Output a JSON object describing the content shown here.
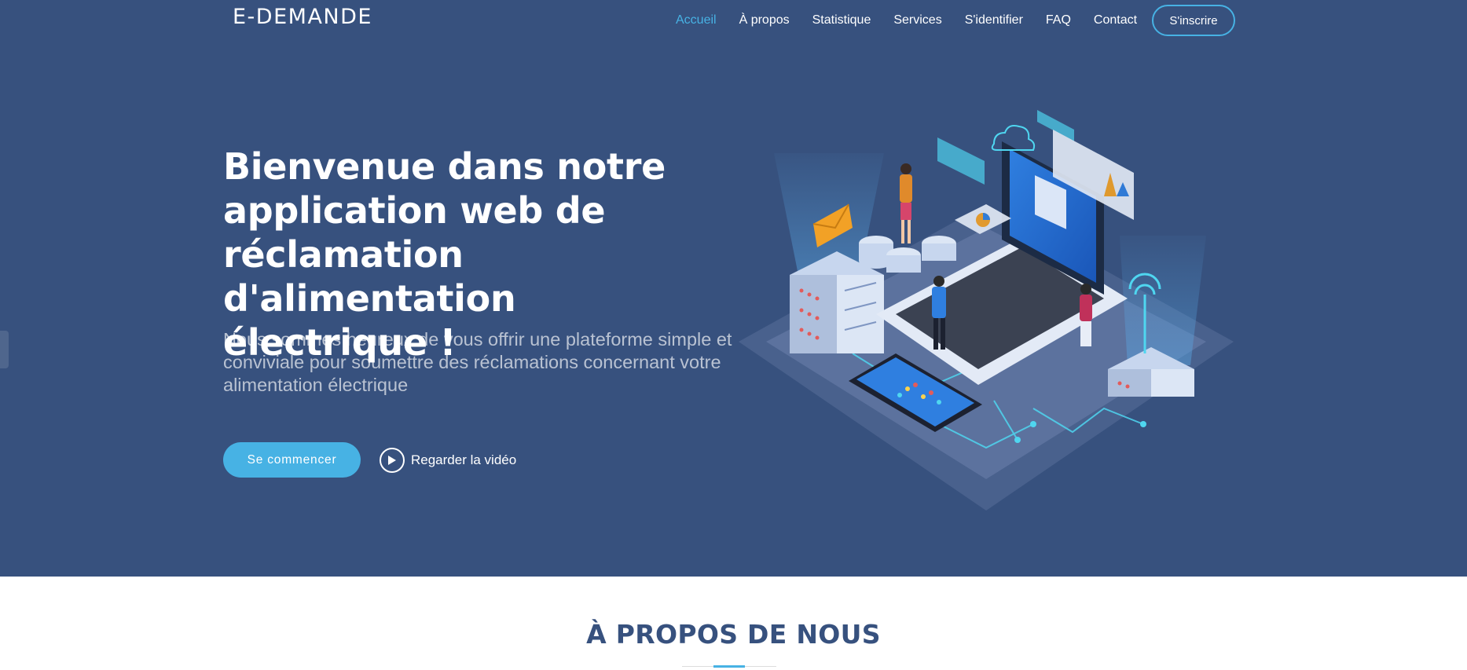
{
  "header": {
    "logo": "E-DEMANDE",
    "nav": [
      {
        "label": "Accueil",
        "active": true
      },
      {
        "label": "À propos"
      },
      {
        "label": "Statistique"
      },
      {
        "label": "Services"
      },
      {
        "label": "S'identifier"
      },
      {
        "label": "FAQ"
      },
      {
        "label": "Contact"
      }
    ],
    "signup_label": "S'inscrire"
  },
  "hero": {
    "title": "Bienvenue dans notre application web de réclamation d'alimentation électrique !",
    "subtitle": "Nous sommes heureux de vous offrir une plateforme simple et conviviale pour soumettre des réclamations concernant votre alimentation électrique",
    "start_button": "Se commencer",
    "video_link": "Regarder la vidéo",
    "illustration_icon": "isometric-tech-illustration"
  },
  "about": {
    "title": "À PROPOS DE NOUS"
  },
  "colors": {
    "hero_bg": "#37517e",
    "accent": "#47b2e4",
    "white": "#ffffff"
  }
}
